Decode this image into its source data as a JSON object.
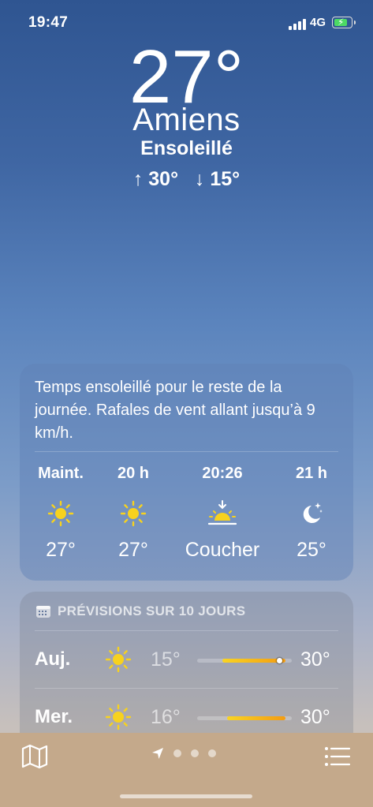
{
  "status_bar": {
    "time": "19:47",
    "network": "4G"
  },
  "header": {
    "city": "Amiens",
    "temperature": "27°",
    "condition": "Ensoleillé",
    "high": "30°",
    "low": "15°"
  },
  "hourly": {
    "summary": "Temps ensoleillé pour le reste de la journée. Rafales de vent allant jusqu’à 9 km/h.",
    "items": [
      {
        "label": "Maint.",
        "icon": "sun-icon",
        "value": "27°"
      },
      {
        "label": "20 h",
        "icon": "sun-icon",
        "value": "27°"
      },
      {
        "label": "20:26",
        "icon": "sunset-icon",
        "value": "Coucher"
      },
      {
        "label": "21 h",
        "icon": "moon-stars-icon",
        "value": "25°"
      }
    ]
  },
  "forecast": {
    "title": "PRÉVISIONS SUR 10 JOURS",
    "days": [
      {
        "day": "Auj.",
        "icon": "sun-icon",
        "low": "15°",
        "high": "30°",
        "range_start": 0.27,
        "range_end": 0.93,
        "current_marker": 0.87
      },
      {
        "day": "Mer.",
        "icon": "sun-icon",
        "low": "16°",
        "high": "30°",
        "range_start": 0.32,
        "range_end": 0.93
      }
    ]
  },
  "bottom_bar": {
    "pages": 3,
    "current_page": "location"
  },
  "colors": {
    "sun": "#f7d21e",
    "range_start": "#f9d423",
    "range_end": "#f39c12",
    "battery": "#4cd964"
  }
}
